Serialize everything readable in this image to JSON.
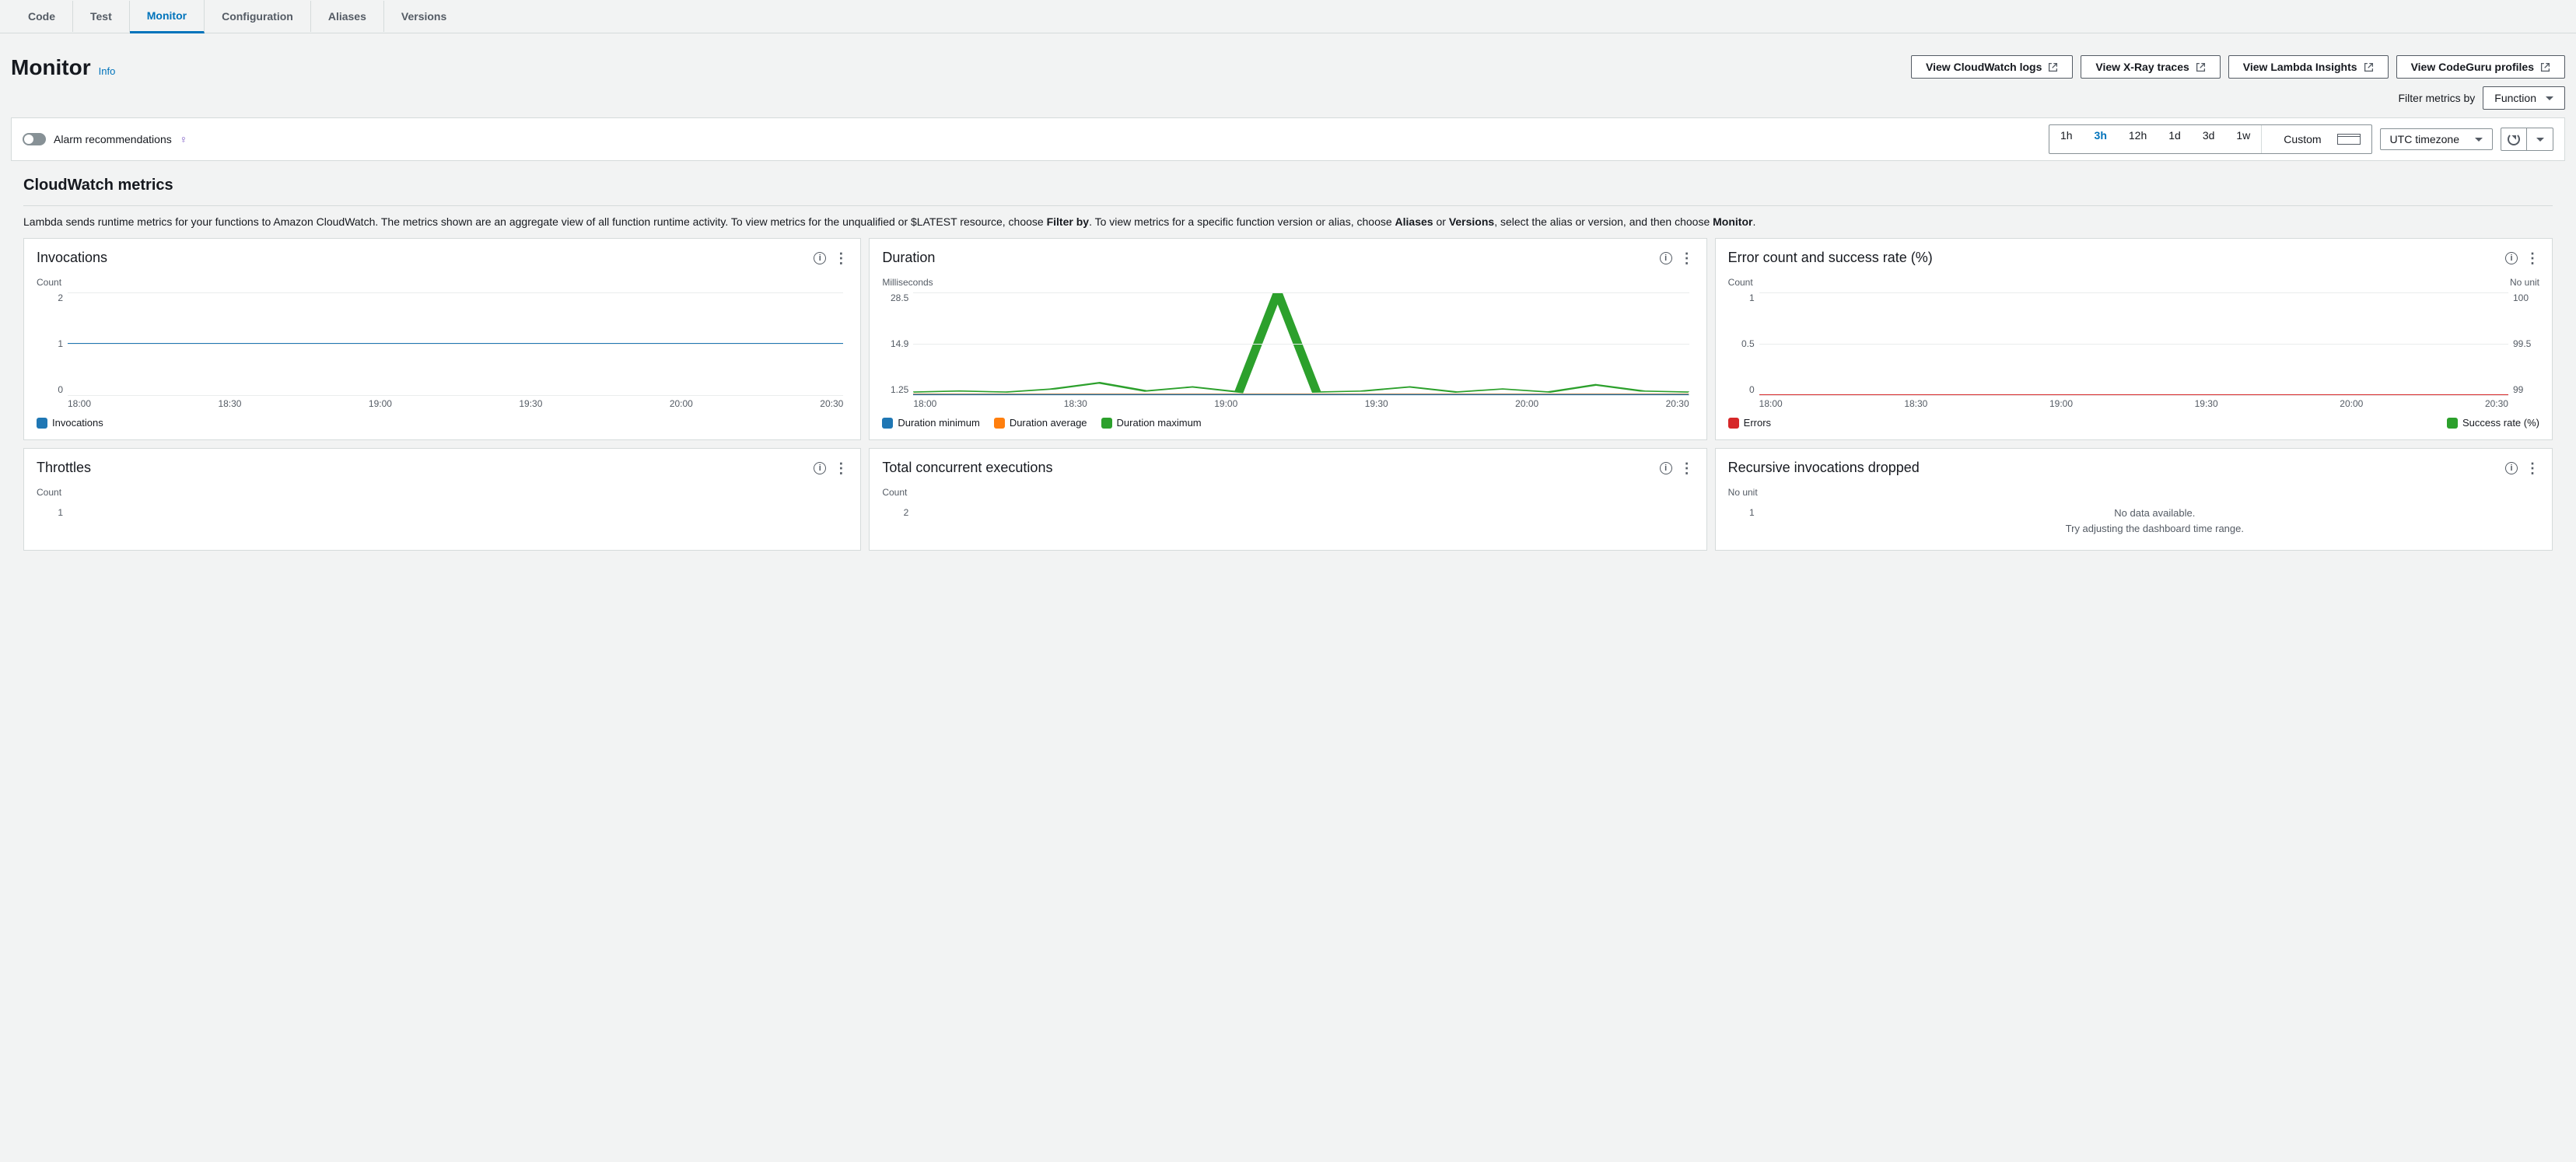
{
  "tabs": [
    "Code",
    "Test",
    "Monitor",
    "Configuration",
    "Aliases",
    "Versions"
  ],
  "active_tab": "Monitor",
  "page_title": "Monitor",
  "info": "Info",
  "header_buttons": [
    "View CloudWatch logs",
    "View X-Ray traces",
    "View Lambda Insights",
    "View CodeGuru profiles"
  ],
  "filter_label": "Filter metrics by",
  "filter_value": "Function",
  "alarm_toggle": "Alarm recommendations",
  "time_ranges": [
    "1h",
    "3h",
    "12h",
    "1d",
    "3d",
    "1w"
  ],
  "time_active": "3h",
  "custom_label": "Custom",
  "timezone": "UTC timezone",
  "section_title": "CloudWatch metrics",
  "section_desc_1": "Lambda sends runtime metrics for your functions to Amazon CloudWatch. The metrics shown are an aggregate view of all function runtime activity. To view metrics for the unqualified or $LATEST resource, choose ",
  "section_desc_filterby": "Filter by",
  "section_desc_2": ". To view metrics for a specific function version or alias, choose ",
  "section_desc_aliases": "Aliases",
  "section_desc_or": " or ",
  "section_desc_versions": "Versions",
  "section_desc_3": ", select the alias or version, and then choose ",
  "section_desc_monitor": "Monitor",
  "section_desc_end": ".",
  "xticks": [
    "18:00",
    "18:30",
    "19:00",
    "19:30",
    "20:00",
    "20:30"
  ],
  "no_data_1": "No data available.",
  "no_data_2": "Try adjusting the dashboard time range.",
  "charts": {
    "invocations": {
      "title": "Invocations",
      "ylabel": "Count",
      "yticks": [
        "2",
        "1",
        "0"
      ],
      "legend": [
        "Invocations"
      ]
    },
    "duration": {
      "title": "Duration",
      "ylabel": "Milliseconds",
      "yticks": [
        "28.5",
        "14.9",
        "1.25"
      ],
      "legend": [
        "Duration minimum",
        "Duration average",
        "Duration maximum"
      ]
    },
    "errors": {
      "title": "Error count and success rate (%)",
      "ylabel": "Count",
      "ylabel_r": "No unit",
      "yticks": [
        "1",
        "0.5",
        "0"
      ],
      "yticks_r": [
        "100",
        "99.5",
        "99"
      ],
      "legend_l": "Errors",
      "legend_r": "Success rate (%)"
    },
    "throttles": {
      "title": "Throttles",
      "ylabel": "Count",
      "yticks": [
        "1"
      ]
    },
    "concurrent": {
      "title": "Total concurrent executions",
      "ylabel": "Count",
      "yticks": [
        "2"
      ]
    },
    "recursive": {
      "title": "Recursive invocations dropped",
      "ylabel": "No unit",
      "yticks": [
        "1"
      ]
    }
  },
  "chart_data": [
    {
      "type": "line",
      "title": "Invocations",
      "ylabel": "Count",
      "x": [
        "18:00",
        "18:30",
        "19:00",
        "19:30",
        "20:00",
        "20:30"
      ],
      "series": [
        {
          "name": "Invocations",
          "values": [
            1,
            1,
            1,
            1,
            1,
            1
          ]
        }
      ],
      "ylim": [
        0,
        2
      ]
    },
    {
      "type": "line",
      "title": "Duration",
      "ylabel": "Milliseconds",
      "x": [
        "18:00",
        "18:30",
        "19:00",
        "19:30",
        "20:00",
        "20:30"
      ],
      "series": [
        {
          "name": "Duration minimum",
          "values_approx": [
            1.3,
            1.3,
            1.3,
            1.3,
            1.3,
            1.3
          ]
        },
        {
          "name": "Duration average",
          "values_approx": [
            1.5,
            1.5,
            1.5,
            1.5,
            1.5,
            1.5
          ]
        },
        {
          "name": "Duration maximum",
          "values_approx": [
            2,
            2,
            3,
            5,
            2,
            4,
            2,
            2,
            28.5,
            2,
            2,
            4,
            2,
            3,
            2,
            5,
            2
          ]
        }
      ],
      "ylim": [
        1.25,
        28.5
      ]
    },
    {
      "type": "line",
      "title": "Error count and success rate (%)",
      "ylabel_left": "Count",
      "ylabel_right": "No unit",
      "x": [
        "18:00",
        "18:30",
        "19:00",
        "19:30",
        "20:00",
        "20:30"
      ],
      "series": [
        {
          "name": "Errors",
          "axis": "left",
          "values": [
            0,
            0,
            0,
            0,
            0,
            0
          ]
        },
        {
          "name": "Success rate (%)",
          "axis": "right",
          "values": [
            100,
            100,
            100,
            100,
            100,
            100
          ]
        }
      ],
      "ylim_left": [
        0,
        1
      ],
      "ylim_right": [
        99,
        100
      ]
    },
    {
      "type": "line",
      "title": "Throttles",
      "ylabel": "Count",
      "series": [],
      "note": "partial view"
    },
    {
      "type": "line",
      "title": "Total concurrent executions",
      "ylabel": "Count",
      "series": [],
      "note": "partial view"
    },
    {
      "type": "line",
      "title": "Recursive invocations dropped",
      "ylabel": "No unit",
      "series": [],
      "note": "No data available."
    }
  ]
}
